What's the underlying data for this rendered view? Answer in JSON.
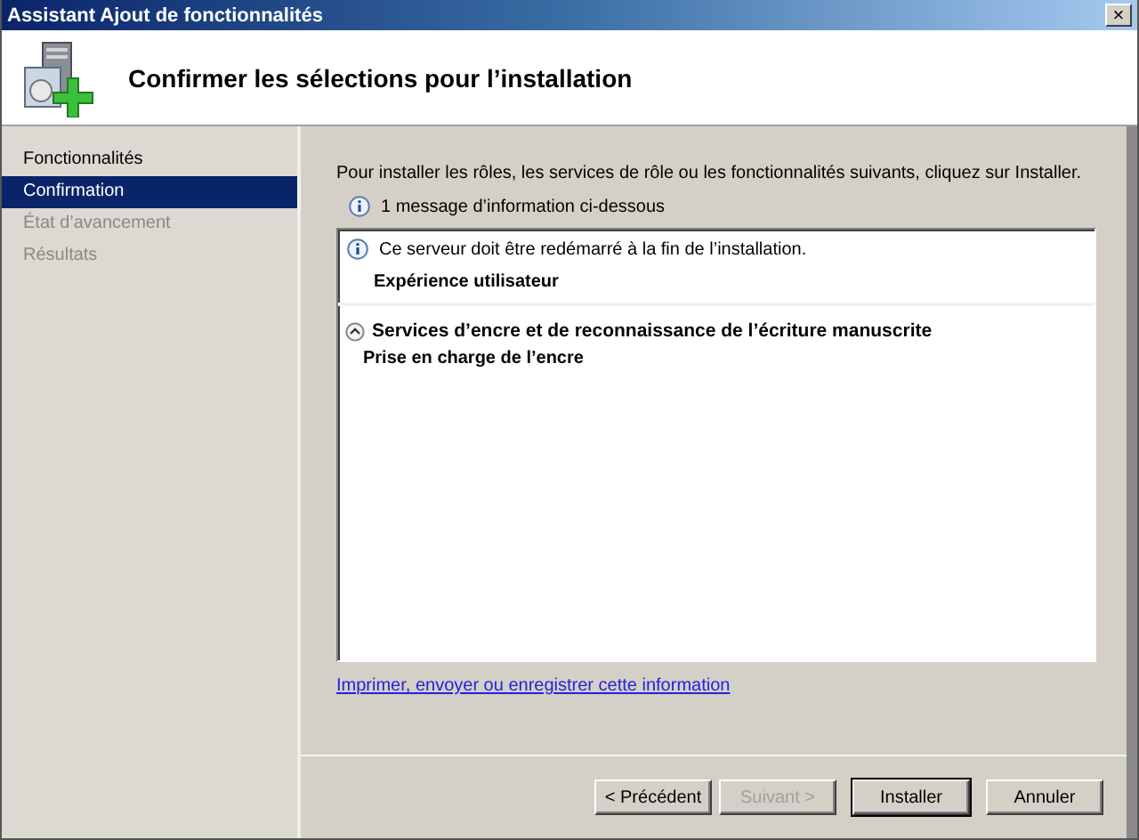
{
  "window": {
    "title": "Assistant Ajout de fonctionnalités",
    "close": "×"
  },
  "header": {
    "title": "Confirmer les sélections pour l’installation"
  },
  "nav": [
    {
      "label": "Fonctionnalités",
      "selected": false,
      "disabled": false
    },
    {
      "label": "Confirmation",
      "selected": true,
      "disabled": false
    },
    {
      "label": "État d’avancement",
      "selected": false,
      "disabled": true
    },
    {
      "label": "Résultats",
      "selected": false,
      "disabled": true
    }
  ],
  "intro": "Pour installer les rôles, les services de rôle ou les fonctionnalités suivants, cliquez sur Installer.",
  "info_summary": "1 message d’information ci-dessous",
  "details": [
    {
      "kind": "info",
      "text": "Ce serveur doit être redémarré à la fin de l’installation."
    },
    {
      "kind": "item",
      "text": "Expérience utilisateur"
    },
    {
      "kind": "group",
      "title": "Services d’encre et de reconnaissance de l’écriture manuscrite",
      "expanded": true,
      "children": [
        {
          "text": "Prise en charge de l’encre"
        }
      ]
    }
  ],
  "link": "Imprimer, envoyer ou enregistrer cette information",
  "buttons": [
    {
      "label": "< Précédent",
      "disabled": false,
      "default": false
    },
    {
      "label": "Suivant >",
      "disabled": true,
      "default": false
    },
    {
      "label": "Installer",
      "disabled": false,
      "default": true
    },
    {
      "label": "Annuler",
      "disabled": false,
      "default": false
    }
  ]
}
